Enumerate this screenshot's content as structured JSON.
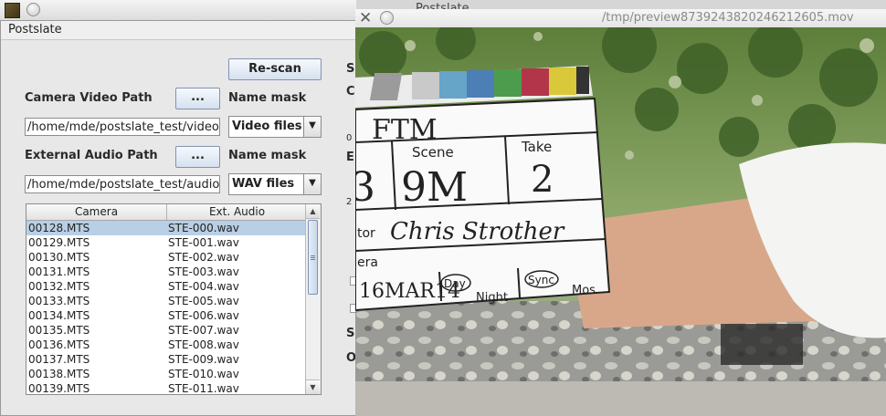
{
  "main_window": {
    "title": "Postslate",
    "menu_label": "Postslate",
    "rescan_label": "Re-scan",
    "camera_video_path_label": "Camera Video Path",
    "browse_label": "...",
    "name_mask_label": "Name mask",
    "camera_video_path_value": "/home/mde/postslate_test/video",
    "video_mask_value": "Video files",
    "external_audio_path_label": "External Audio Path",
    "external_audio_path_value": "/home/mde/postslate_test/audio",
    "audio_mask_value": "WAV files",
    "right_partial_labels": [
      "S",
      "C",
      "0",
      "E",
      "2",
      "S",
      "O"
    ]
  },
  "table": {
    "columns": [
      "Camera",
      "Ext. Audio"
    ],
    "rows": [
      [
        "00128.MTS",
        "STE-000.wav"
      ],
      [
        "00129.MTS",
        "STE-001.wav"
      ],
      [
        "00130.MTS",
        "STE-002.wav"
      ],
      [
        "00131.MTS",
        "STE-003.wav"
      ],
      [
        "00132.MTS",
        "STE-004.wav"
      ],
      [
        "00133.MTS",
        "STE-005.wav"
      ],
      [
        "00134.MTS",
        "STE-006.wav"
      ],
      [
        "00135.MTS",
        "STE-007.wav"
      ],
      [
        "00136.MTS",
        "STE-008.wav"
      ],
      [
        "00137.MTS",
        "STE-009.wav"
      ],
      [
        "00138.MTS",
        "STE-010.wav"
      ],
      [
        "00139.MTS",
        "STE-011.wav"
      ]
    ],
    "selected_row": 0
  },
  "preview_window": {
    "title": "/tmp/preview8739243820246212605.mov",
    "background_title": "Postslate"
  },
  "clapperboard": {
    "production": "FTM",
    "scene_label": "Scene",
    "take_label": "Take",
    "roll_value": "3",
    "scene_value": "9M",
    "take_value": "2",
    "director_partial": "tor",
    "director_name": "Chris Strother",
    "camera_partial": "era",
    "date": "16MAR14",
    "day_label": "Day",
    "night_label": "Night",
    "sync_label": "Sync",
    "mos_label": "Mos"
  },
  "colors": {
    "table_selection": "#b8cfe5",
    "button_gradient_bottom": "#d5e1ef"
  }
}
